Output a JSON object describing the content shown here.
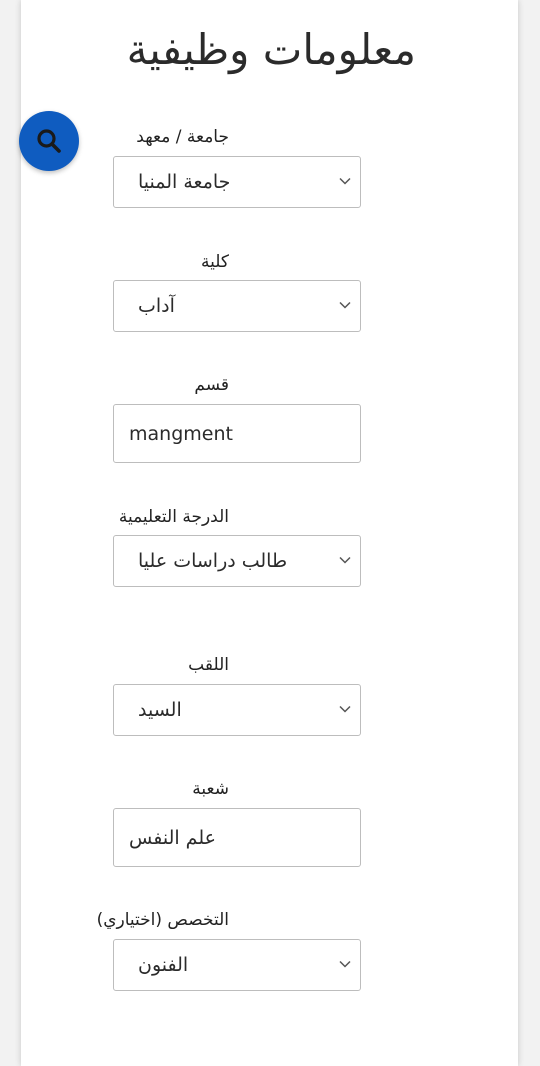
{
  "page": {
    "title": "معلومات وظيفية"
  },
  "search_fab": {
    "icon": "search-icon",
    "color": "#0f5cc0"
  },
  "fields": [
    {
      "label": "جامعة / معهد",
      "type": "select",
      "value": "جامعة المنيا"
    },
    {
      "label": "كلية",
      "type": "select",
      "value": "آداب"
    },
    {
      "label": "قسم",
      "type": "text",
      "value": "mangment"
    },
    {
      "label": "الدرجة التعليمية",
      "type": "select",
      "value": "طالب دراسات عليا"
    },
    {
      "label": "اللقب",
      "type": "select",
      "value": "السيد"
    },
    {
      "label": "شعبة",
      "type": "text",
      "value": "علم النفس"
    },
    {
      "label": "التخصص (اختياري)",
      "type": "select",
      "value": "الفنون"
    }
  ]
}
